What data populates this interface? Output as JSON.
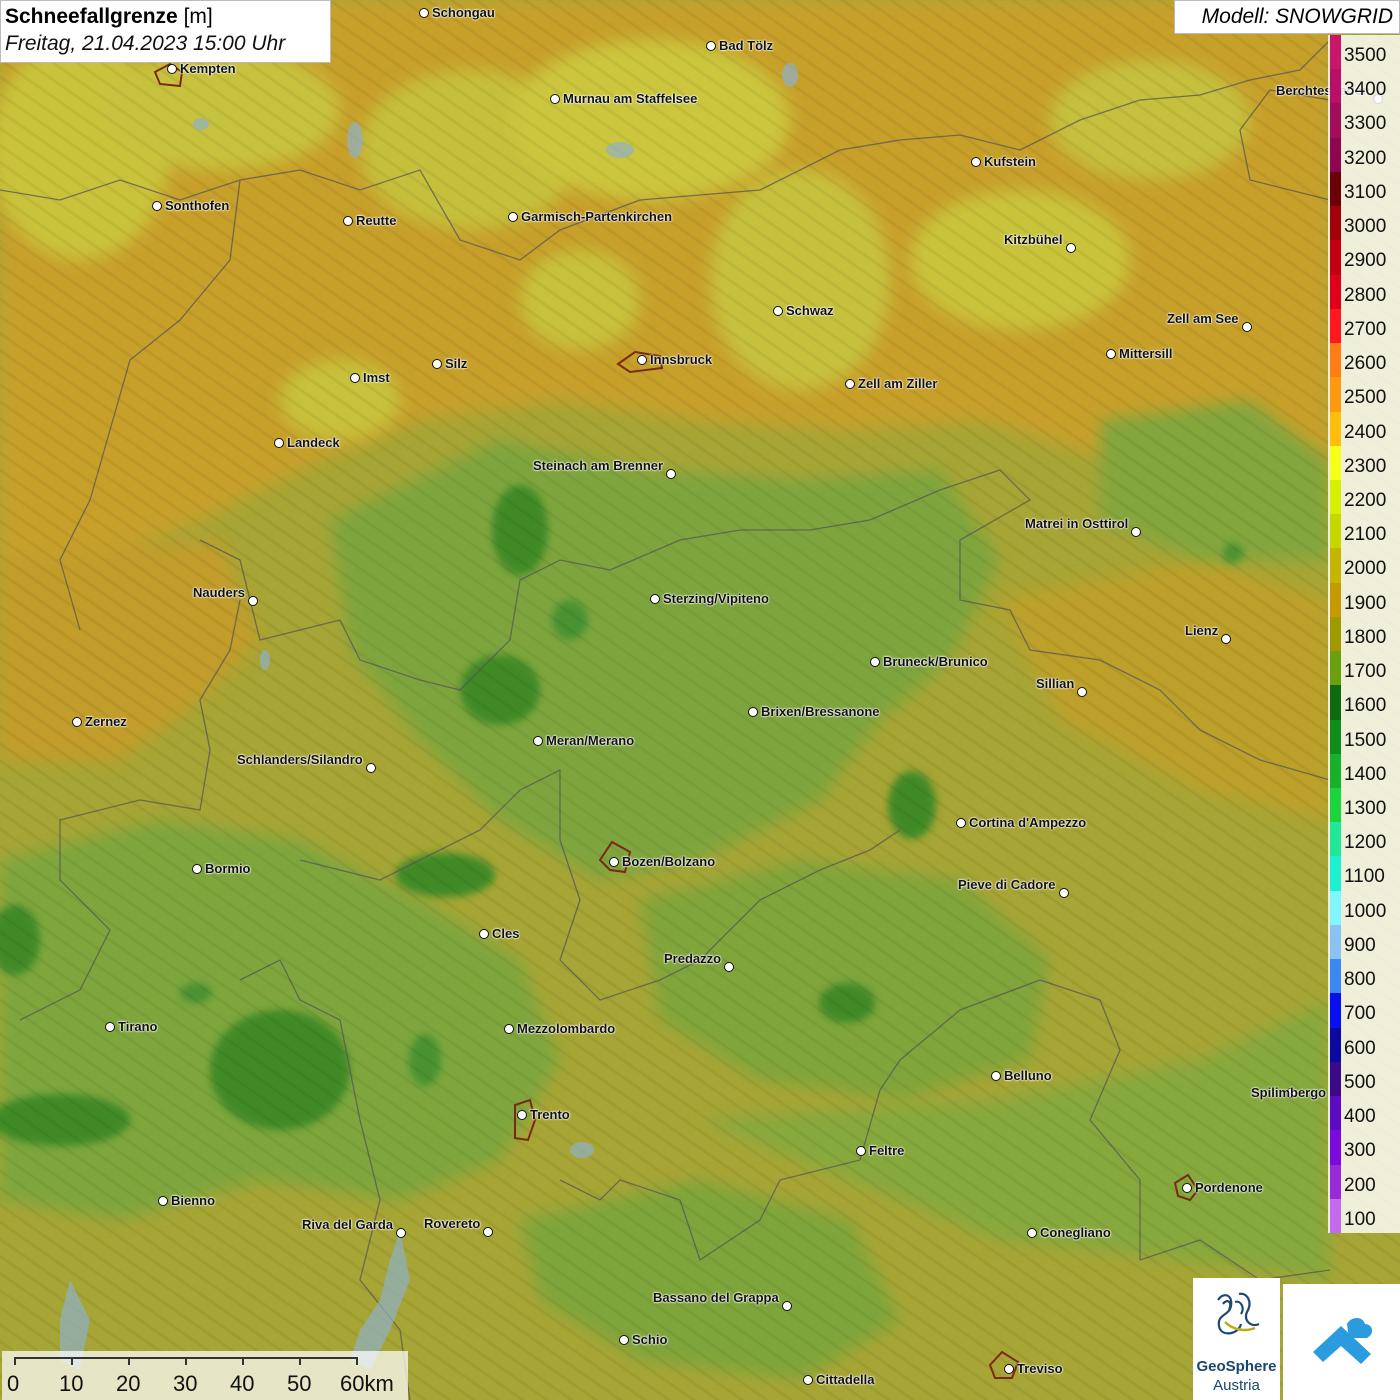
{
  "title": {
    "main": "Schneefallgrenze",
    "unit": "[m]",
    "datetime": "Freitag, 21.04.2023 15:00 Uhr"
  },
  "model": {
    "label": "Modell: SNOWGRID"
  },
  "legend": [
    {
      "value": "3500",
      "color": "#c8166b"
    },
    {
      "value": "3400",
      "color": "#b80f68"
    },
    {
      "value": "3300",
      "color": "#a20c5c"
    },
    {
      "value": "3200",
      "color": "#8e0652"
    },
    {
      "value": "3100",
      "color": "#6a0008"
    },
    {
      "value": "3000",
      "color": "#a30009"
    },
    {
      "value": "2900",
      "color": "#c30010"
    },
    {
      "value": "2800",
      "color": "#e0001c"
    },
    {
      "value": "2700",
      "color": "#ff1820"
    },
    {
      "value": "2600",
      "color": "#ff7d14"
    },
    {
      "value": "2500",
      "color": "#ff9a10"
    },
    {
      "value": "2400",
      "color": "#ffbe0c"
    },
    {
      "value": "2300",
      "color": "#f6ff19"
    },
    {
      "value": "2200",
      "color": "#d5f000"
    },
    {
      "value": "2100",
      "color": "#c8d600"
    },
    {
      "value": "2000",
      "color": "#c4b600"
    },
    {
      "value": "1900",
      "color": "#c49a00"
    },
    {
      "value": "1800",
      "color": "#a09a00"
    },
    {
      "value": "1700",
      "color": "#6aa010"
    },
    {
      "value": "1600",
      "color": "#0e6b10"
    },
    {
      "value": "1500",
      "color": "#0f8d1a"
    },
    {
      "value": "1400",
      "color": "#18b22a"
    },
    {
      "value": "1300",
      "color": "#1ed43c"
    },
    {
      "value": "1200",
      "color": "#21e899"
    },
    {
      "value": "1100",
      "color": "#1ef0d2"
    },
    {
      "value": "1000",
      "color": "#82f6ff"
    },
    {
      "value": "900",
      "color": "#8ac2f2"
    },
    {
      "value": "800",
      "color": "#3a88f0"
    },
    {
      "value": "700",
      "color": "#0a0ff0"
    },
    {
      "value": "600",
      "color": "#0a0aa0"
    },
    {
      "value": "500",
      "color": "#3a0a8a"
    },
    {
      "value": "400",
      "color": "#5c0ac4"
    },
    {
      "value": "300",
      "color": "#7a0ade"
    },
    {
      "value": "200",
      "color": "#9a2ad8"
    },
    {
      "value": "100",
      "color": "#c46aee"
    }
  ],
  "scalebar": {
    "labels": [
      "0",
      "10",
      "20",
      "30",
      "40",
      "50",
      "60km"
    ]
  },
  "logos": {
    "geosphere_line1": "GeoSphere",
    "geosphere_line2": "Austria"
  },
  "cities": [
    {
      "name": "Schongau",
      "label_side": "right"
    },
    {
      "name": "Bad Tölz",
      "label_side": "right"
    },
    {
      "name": "Kempten",
      "label_side": "right"
    },
    {
      "name": "Murnau am Staffelsee",
      "label_side": "right"
    },
    {
      "name": "Berchtesgaden",
      "label_side": "left"
    },
    {
      "name": "Kufstein",
      "label_side": "right"
    },
    {
      "name": "Sonthofen",
      "label_side": "right"
    },
    {
      "name": "Reutte",
      "label_side": "right"
    },
    {
      "name": "Garmisch-Partenkirchen",
      "label_side": "right"
    },
    {
      "name": "Kitzbühel",
      "label_side": "left"
    },
    {
      "name": "Schwaz",
      "label_side": "right"
    },
    {
      "name": "Zell am See",
      "label_side": "left"
    },
    {
      "name": "Mittersill",
      "label_side": "right"
    },
    {
      "name": "Imst",
      "label_side": "right"
    },
    {
      "name": "Silz",
      "label_side": "right"
    },
    {
      "name": "Innsbruck",
      "label_side": "right"
    },
    {
      "name": "Zell am Ziller",
      "label_side": "right"
    },
    {
      "name": "Landeck",
      "label_side": "right"
    },
    {
      "name": "Steinach am Brenner",
      "label_side": "left"
    },
    {
      "name": "Matrei in Osttirol",
      "label_side": "left"
    },
    {
      "name": "Nauders",
      "label_side": "left"
    },
    {
      "name": "Sterzing/Vipiteno",
      "label_side": "right"
    },
    {
      "name": "Lienz",
      "label_side": "left"
    },
    {
      "name": "Bruneck/Brunico",
      "label_side": "right"
    },
    {
      "name": "Sillian",
      "label_side": "left"
    },
    {
      "name": "Zernez",
      "label_side": "right"
    },
    {
      "name": "Brixen/Bressanone",
      "label_side": "right"
    },
    {
      "name": "Meran/Merano",
      "label_side": "right"
    },
    {
      "name": "Schlanders/Silandro",
      "label_side": "left"
    },
    {
      "name": "Cortina d'Ampezzo",
      "label_side": "right"
    },
    {
      "name": "Bormio",
      "label_side": "right"
    },
    {
      "name": "Bozen/Bolzano",
      "label_side": "right"
    },
    {
      "name": "Pieve di Cadore",
      "label_side": "left"
    },
    {
      "name": "Cles",
      "label_side": "right"
    },
    {
      "name": "Predazzo",
      "label_side": "left"
    },
    {
      "name": "Tirano",
      "label_side": "right"
    },
    {
      "name": "Mezzolombardo",
      "label_side": "right"
    },
    {
      "name": "Belluno",
      "label_side": "right"
    },
    {
      "name": "Spilimbergo",
      "label_side": "right"
    },
    {
      "name": "Trento",
      "label_side": "right"
    },
    {
      "name": "Feltre",
      "label_side": "right"
    },
    {
      "name": "Pordenone",
      "label_side": "right"
    },
    {
      "name": "Bienno",
      "label_side": "right"
    },
    {
      "name": "Riva del Garda",
      "label_side": "left"
    },
    {
      "name": "Rovereto",
      "label_side": "left"
    },
    {
      "name": "Conegliano",
      "label_side": "right"
    },
    {
      "name": "Bassano del Grappa",
      "label_side": "left"
    },
    {
      "name": "Schio",
      "label_side": "right"
    },
    {
      "name": "Treviso",
      "label_side": "right"
    },
    {
      "name": "Cittadella",
      "label_side": "right"
    }
  ]
}
